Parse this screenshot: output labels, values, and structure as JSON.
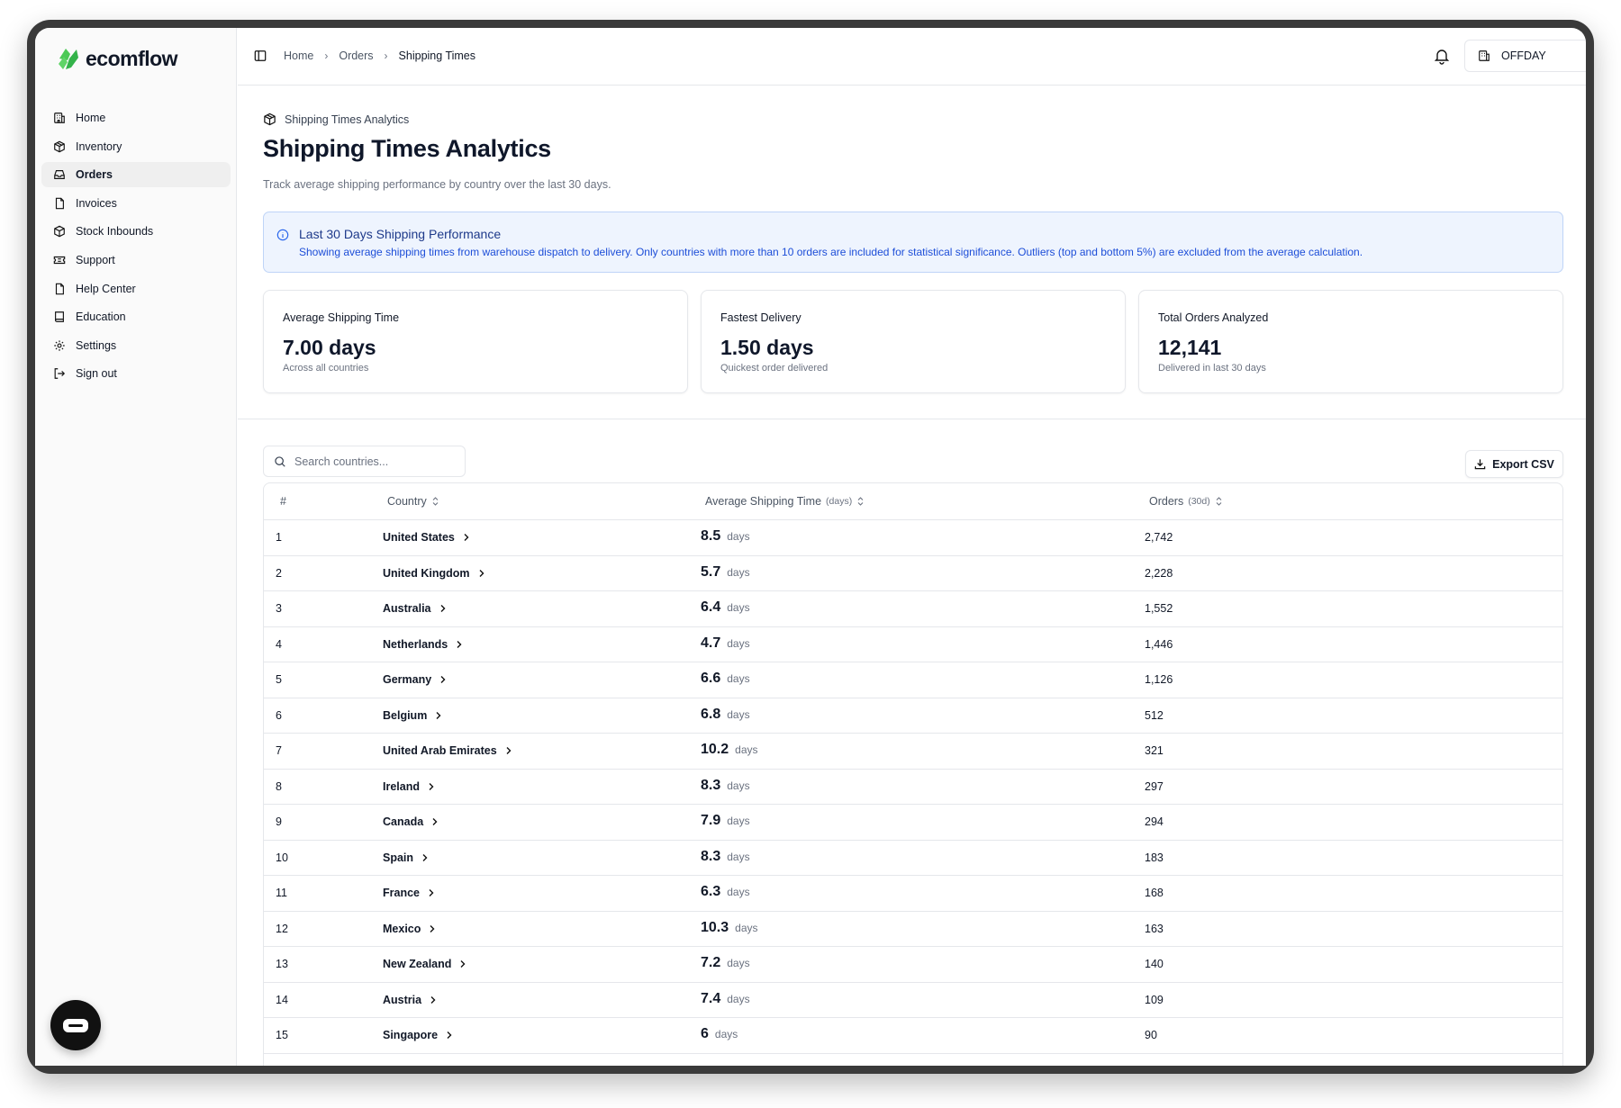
{
  "brand": {
    "name": "ecomflow"
  },
  "sidebar": {
    "items": [
      {
        "label": "Home",
        "icon": "building-icon"
      },
      {
        "label": "Inventory",
        "icon": "box-icon"
      },
      {
        "label": "Orders",
        "icon": "inbox-icon",
        "active": true
      },
      {
        "label": "Invoices",
        "icon": "file-icon"
      },
      {
        "label": "Stock Inbounds",
        "icon": "package-icon"
      },
      {
        "label": "Support",
        "icon": "ticket-icon"
      },
      {
        "label": "Help Center",
        "icon": "document-icon"
      },
      {
        "label": "Education",
        "icon": "book-icon"
      },
      {
        "label": "Settings",
        "icon": "gear-icon"
      },
      {
        "label": "Sign out",
        "icon": "sign-out-icon"
      }
    ]
  },
  "header": {
    "breadcrumbs": [
      "Home",
      "Orders",
      "Shipping Times"
    ],
    "store": "OFFDAY"
  },
  "page": {
    "section_label": "Shipping Times Analytics",
    "title": "Shipping Times Analytics",
    "subtitle": "Track average shipping performance by country over the last 30 days."
  },
  "alert": {
    "title": "Last 30 Days Shipping Performance",
    "body": "Showing average shipping times from warehouse dispatch to delivery. Only countries with more than 10 orders are included for statistical significance. Outliers (top and bottom 5%) are excluded from the average calculation."
  },
  "stats": [
    {
      "label": "Average Shipping Time",
      "value": "7.00 days",
      "note": "Across all countries"
    },
    {
      "label": "Fastest Delivery",
      "value": "1.50 days",
      "note": "Quickest order delivered"
    },
    {
      "label": "Total Orders Analyzed",
      "value": "12,141",
      "note": "Delivered in last 30 days"
    }
  ],
  "toolbar": {
    "search_placeholder": "Search countries...",
    "export_label": "Export CSV"
  },
  "table": {
    "columns": {
      "rank": "#",
      "country": "Country",
      "time": "Average Shipping Time",
      "time_unit": "(days)",
      "orders": "Orders",
      "orders_unit": "(30d)"
    },
    "day_unit": "days",
    "rows": [
      {
        "rank": "1",
        "country": "United States",
        "time": "8.5",
        "orders": "2,742"
      },
      {
        "rank": "2",
        "country": "United Kingdom",
        "time": "5.7",
        "orders": "2,228"
      },
      {
        "rank": "3",
        "country": "Australia",
        "time": "6.4",
        "orders": "1,552"
      },
      {
        "rank": "4",
        "country": "Netherlands",
        "time": "4.7",
        "orders": "1,446"
      },
      {
        "rank": "5",
        "country": "Germany",
        "time": "6.6",
        "orders": "1,126"
      },
      {
        "rank": "6",
        "country": "Belgium",
        "time": "6.8",
        "orders": "512"
      },
      {
        "rank": "7",
        "country": "United Arab Emirates",
        "time": "10.2",
        "orders": "321"
      },
      {
        "rank": "8",
        "country": "Ireland",
        "time": "8.3",
        "orders": "297"
      },
      {
        "rank": "9",
        "country": "Canada",
        "time": "7.9",
        "orders": "294"
      },
      {
        "rank": "10",
        "country": "Spain",
        "time": "8.3",
        "orders": "183"
      },
      {
        "rank": "11",
        "country": "France",
        "time": "6.3",
        "orders": "168"
      },
      {
        "rank": "12",
        "country": "Mexico",
        "time": "10.3",
        "orders": "163"
      },
      {
        "rank": "13",
        "country": "New Zealand",
        "time": "7.2",
        "orders": "140"
      },
      {
        "rank": "14",
        "country": "Austria",
        "time": "7.4",
        "orders": "109"
      },
      {
        "rank": "15",
        "country": "Singapore",
        "time": "6",
        "orders": "90"
      }
    ]
  },
  "colors": {
    "accent_green": "#3fbf4a",
    "alert_bg": "#eef4fe",
    "alert_text": "#1d4ed8"
  }
}
